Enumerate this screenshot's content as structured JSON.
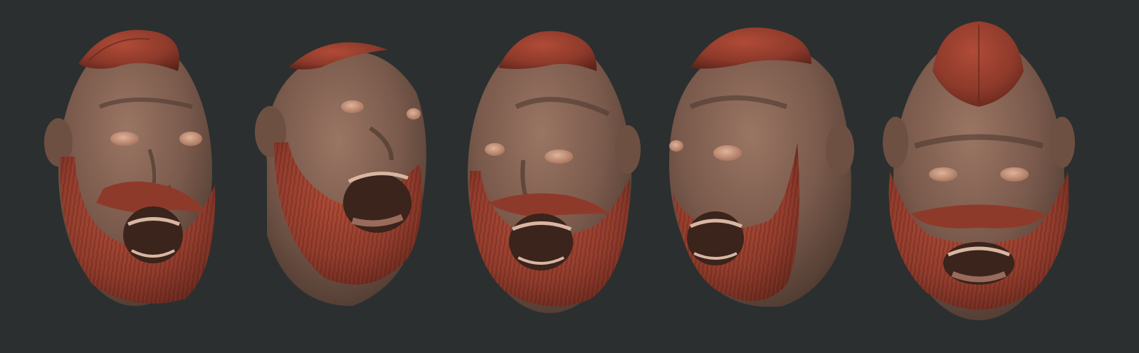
{
  "scene": {
    "background_color": "#2b2f2f",
    "skin_color": "#7a5a4c",
    "skin_highlight_color": "#9a7563",
    "skin_shadow_color": "#4e3a31",
    "hair_color": "#8e3a2b",
    "hair_highlight_color": "#b04b37",
    "hair_shadow_color": "#5e241a",
    "eye_color": "#c9977f",
    "mouth_color": "#3a241c",
    "teeth_color": "#d8b6a2"
  },
  "renders": [
    {
      "view": "front-left-three-quarter"
    },
    {
      "view": "left-side-tilted"
    },
    {
      "view": "front-right-three-quarter"
    },
    {
      "view": "right-three-quarter"
    },
    {
      "view": "front"
    }
  ]
}
